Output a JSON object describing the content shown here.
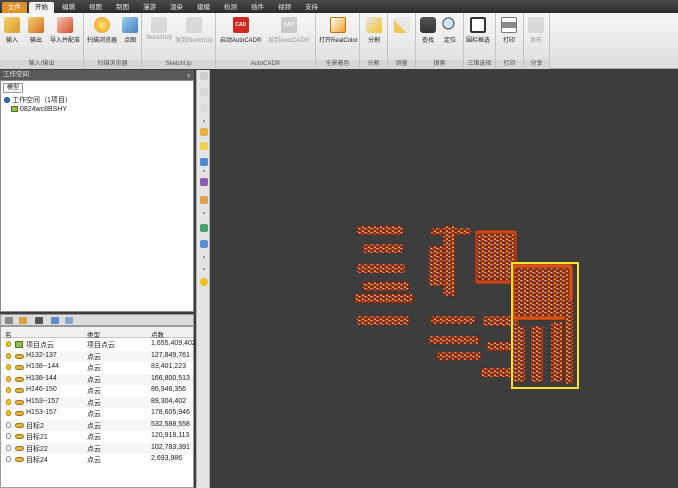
{
  "tabs": [
    "文件",
    "开始",
    "编辑",
    "视图",
    "制图",
    "漫游",
    "渲染",
    "建模",
    "检测",
    "插件",
    "视频",
    "支持"
  ],
  "active_tab": "开始",
  "ribbon": {
    "groups": [
      {
        "label": "输入/输出",
        "buttons": [
          "输入",
          "输出",
          "导入并配准"
        ]
      },
      {
        "label": "扫描浏览器",
        "buttons": [
          "扫描浏览器",
          "点图"
        ]
      },
      {
        "label": "SketchUp",
        "buttons": [
          "SketchUp",
          "发到SketchUp"
        ]
      },
      {
        "label": "AutoCAD®",
        "buttons": [
          "启动AutoCAD®",
          "发到AutoCAD®"
        ]
      },
      {
        "label": "全景着色",
        "buttons": [
          "打开RealColor"
        ]
      },
      {
        "label": "分割",
        "buttons": [
          "分割"
        ]
      },
      {
        "label": "测量",
        "buttons": []
      },
      {
        "label": "搜索",
        "buttons": [
          "查找",
          "定位"
        ]
      },
      {
        "label": "三维选择",
        "buttons": [
          "围栏框选"
        ]
      },
      {
        "label": "打印",
        "buttons": [
          "打印"
        ]
      },
      {
        "label": "分享",
        "buttons": [
          "发布"
        ]
      }
    ],
    "cad_badge": "CAD"
  },
  "workspace": {
    "title": "工作空间",
    "pin": "ᵩ",
    "tab_label": "模型",
    "root": "工作空间（1项目）",
    "project": "0824wc8BSHY"
  },
  "list": {
    "headers": [
      "名",
      "类型",
      "点数"
    ],
    "rows": [
      {
        "name": "项目点云",
        "type": "项目点云",
        "count": "1,655,409,402",
        "on": true,
        "kind": "project"
      },
      {
        "name": "H132-137",
        "type": "点云",
        "count": "127,849,761",
        "on": true,
        "kind": "cloud"
      },
      {
        "name": "H138--144",
        "type": "点云",
        "count": "83,401,223",
        "on": true,
        "kind": "cloud"
      },
      {
        "name": "H138-144",
        "type": "点云",
        "count": "166,800,513",
        "on": true,
        "kind": "cloud"
      },
      {
        "name": "H146-150",
        "type": "点云",
        "count": "86,946,356",
        "on": true,
        "kind": "cloud"
      },
      {
        "name": "H153--157",
        "type": "点云",
        "count": "89,304,402",
        "on": true,
        "kind": "cloud"
      },
      {
        "name": "H153-157",
        "type": "点云",
        "count": "178,605,946",
        "on": true,
        "kind": "cloud"
      },
      {
        "name": "目标2",
        "type": "点云",
        "count": "532,588,558",
        "on": false,
        "kind": "cloud"
      },
      {
        "name": "目标21",
        "type": "点云",
        "count": "120,918,113",
        "on": false,
        "kind": "cloud"
      },
      {
        "name": "目标22",
        "type": "点云",
        "count": "102,783,391",
        "on": false,
        "kind": "cloud"
      },
      {
        "name": "目标24",
        "type": "点云",
        "count": "2,693,986",
        "on": false,
        "kind": "cloud"
      }
    ]
  },
  "colors": {
    "selection": "#f4e52a",
    "accent": "#e0902a",
    "viewport": "#3d3d3d"
  }
}
